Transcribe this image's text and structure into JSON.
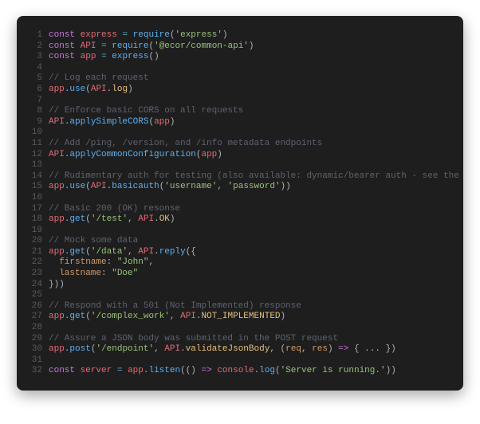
{
  "code": {
    "lines": [
      {
        "n": 1,
        "tokens": [
          [
            "kw",
            "const"
          ],
          [
            "pl",
            " "
          ],
          [
            "id",
            "express"
          ],
          [
            "pl",
            " "
          ],
          [
            "op",
            "="
          ],
          [
            "pl",
            " "
          ],
          [
            "fn",
            "require"
          ],
          [
            "pl",
            "("
          ],
          [
            "str",
            "'express'"
          ],
          [
            "pl",
            ")"
          ]
        ]
      },
      {
        "n": 2,
        "tokens": [
          [
            "kw",
            "const"
          ],
          [
            "pl",
            " "
          ],
          [
            "id",
            "API"
          ],
          [
            "pl",
            " "
          ],
          [
            "op",
            "="
          ],
          [
            "pl",
            " "
          ],
          [
            "fn",
            "require"
          ],
          [
            "pl",
            "("
          ],
          [
            "str",
            "'@ecor/common-api'"
          ],
          [
            "pl",
            ")"
          ]
        ]
      },
      {
        "n": 3,
        "tokens": [
          [
            "kw",
            "const"
          ],
          [
            "pl",
            " "
          ],
          [
            "id",
            "app"
          ],
          [
            "pl",
            " "
          ],
          [
            "op",
            "="
          ],
          [
            "pl",
            " "
          ],
          [
            "fn",
            "express"
          ],
          [
            "pl",
            "()"
          ]
        ]
      },
      {
        "n": 4,
        "tokens": []
      },
      {
        "n": 5,
        "tokens": [
          [
            "cmt",
            "// Log each request"
          ]
        ]
      },
      {
        "n": 6,
        "tokens": [
          [
            "id",
            "app"
          ],
          [
            "pl",
            "."
          ],
          [
            "fn",
            "use"
          ],
          [
            "pl",
            "("
          ],
          [
            "id",
            "API"
          ],
          [
            "pl",
            "."
          ],
          [
            "prop",
            "log"
          ],
          [
            "pl",
            ")"
          ]
        ]
      },
      {
        "n": 7,
        "tokens": []
      },
      {
        "n": 8,
        "tokens": [
          [
            "cmt",
            "// Enforce basic CORS on all requests"
          ]
        ]
      },
      {
        "n": 9,
        "tokens": [
          [
            "id",
            "API"
          ],
          [
            "pl",
            "."
          ],
          [
            "fn",
            "applySimpleCORS"
          ],
          [
            "pl",
            "("
          ],
          [
            "id",
            "app"
          ],
          [
            "pl",
            ")"
          ]
        ]
      },
      {
        "n": 10,
        "tokens": []
      },
      {
        "n": 11,
        "tokens": [
          [
            "cmt",
            "// Add /ping, /version, and /info metadata endpoints"
          ]
        ]
      },
      {
        "n": 12,
        "tokens": [
          [
            "id",
            "API"
          ],
          [
            "pl",
            "."
          ],
          [
            "fn",
            "applyCommonConfiguration"
          ],
          [
            "pl",
            "("
          ],
          [
            "id",
            "app"
          ],
          [
            "pl",
            ")"
          ]
        ]
      },
      {
        "n": 13,
        "tokens": []
      },
      {
        "n": 14,
        "tokens": [
          [
            "cmt",
            "// Rudimentary auth for testing (also available: dynamic/bearer auth - see the docs)"
          ]
        ]
      },
      {
        "n": 15,
        "tokens": [
          [
            "id",
            "app"
          ],
          [
            "pl",
            "."
          ],
          [
            "fn",
            "use"
          ],
          [
            "pl",
            "("
          ],
          [
            "id",
            "API"
          ],
          [
            "pl",
            "."
          ],
          [
            "fn",
            "basicauth"
          ],
          [
            "pl",
            "("
          ],
          [
            "str",
            "'username'"
          ],
          [
            "pl",
            ", "
          ],
          [
            "str",
            "'password'"
          ],
          [
            "pl",
            "))"
          ]
        ]
      },
      {
        "n": 16,
        "tokens": []
      },
      {
        "n": 17,
        "tokens": [
          [
            "cmt",
            "// Basic 200 (OK) resonse"
          ]
        ]
      },
      {
        "n": 18,
        "tokens": [
          [
            "id",
            "app"
          ],
          [
            "pl",
            "."
          ],
          [
            "fn",
            "get"
          ],
          [
            "pl",
            "("
          ],
          [
            "str",
            "'/test'"
          ],
          [
            "pl",
            ", "
          ],
          [
            "id",
            "API"
          ],
          [
            "pl",
            "."
          ],
          [
            "prop",
            "OK"
          ],
          [
            "pl",
            ")"
          ]
        ]
      },
      {
        "n": 19,
        "tokens": []
      },
      {
        "n": 20,
        "tokens": [
          [
            "cmt",
            "// Mock some data"
          ]
        ]
      },
      {
        "n": 21,
        "tokens": [
          [
            "id",
            "app"
          ],
          [
            "pl",
            "."
          ],
          [
            "fn",
            "get"
          ],
          [
            "pl",
            "("
          ],
          [
            "str",
            "'/data'"
          ],
          [
            "pl",
            ", "
          ],
          [
            "id",
            "API"
          ],
          [
            "pl",
            "."
          ],
          [
            "fn",
            "reply"
          ],
          [
            "pl",
            "({"
          ]
        ]
      },
      {
        "n": 22,
        "tokens": [
          [
            "pl",
            "  "
          ],
          [
            "attr",
            "firstname"
          ],
          [
            "pl",
            ": "
          ],
          [
            "str",
            "\"John\""
          ],
          [
            "pl",
            ","
          ]
        ]
      },
      {
        "n": 23,
        "tokens": [
          [
            "pl",
            "  "
          ],
          [
            "attr",
            "lastname"
          ],
          [
            "pl",
            ": "
          ],
          [
            "str",
            "\"Doe\""
          ]
        ]
      },
      {
        "n": 24,
        "tokens": [
          [
            "pl",
            "}))"
          ]
        ]
      },
      {
        "n": 25,
        "tokens": []
      },
      {
        "n": 26,
        "tokens": [
          [
            "cmt",
            "// Respond with a 501 (Not Implemented) response"
          ]
        ]
      },
      {
        "n": 27,
        "tokens": [
          [
            "id",
            "app"
          ],
          [
            "pl",
            "."
          ],
          [
            "fn",
            "get"
          ],
          [
            "pl",
            "("
          ],
          [
            "str",
            "'/complex_work'"
          ],
          [
            "pl",
            ", "
          ],
          [
            "id",
            "API"
          ],
          [
            "pl",
            "."
          ],
          [
            "prop",
            "NOT_IMPLEMENTED"
          ],
          [
            "pl",
            ")"
          ]
        ]
      },
      {
        "n": 28,
        "tokens": []
      },
      {
        "n": 29,
        "tokens": [
          [
            "cmt",
            "// Assure a JSON body was submitted in the POST request"
          ]
        ]
      },
      {
        "n": 30,
        "tokens": [
          [
            "id",
            "app"
          ],
          [
            "pl",
            "."
          ],
          [
            "fn",
            "post"
          ],
          [
            "pl",
            "("
          ],
          [
            "str",
            "'/endpoint'"
          ],
          [
            "pl",
            ", "
          ],
          [
            "id",
            "API"
          ],
          [
            "pl",
            "."
          ],
          [
            "prop",
            "validateJsonBody"
          ],
          [
            "pl",
            ", ("
          ],
          [
            "attr",
            "req"
          ],
          [
            "pl",
            ", "
          ],
          [
            "attr",
            "res"
          ],
          [
            "pl",
            ") "
          ],
          [
            "kw",
            "=>"
          ],
          [
            "pl",
            " { "
          ],
          [
            "pl",
            "..."
          ],
          [
            "pl",
            " })"
          ]
        ]
      },
      {
        "n": 31,
        "tokens": []
      },
      {
        "n": 32,
        "tokens": [
          [
            "kw",
            "const"
          ],
          [
            "pl",
            " "
          ],
          [
            "id",
            "server"
          ],
          [
            "pl",
            " "
          ],
          [
            "op",
            "="
          ],
          [
            "pl",
            " "
          ],
          [
            "id",
            "app"
          ],
          [
            "pl",
            "."
          ],
          [
            "fn",
            "listen"
          ],
          [
            "pl",
            "(() "
          ],
          [
            "kw",
            "=>"
          ],
          [
            "pl",
            " "
          ],
          [
            "id",
            "console"
          ],
          [
            "pl",
            "."
          ],
          [
            "fn",
            "log"
          ],
          [
            "pl",
            "("
          ],
          [
            "str",
            "'Server is running.'"
          ],
          [
            "pl",
            "))"
          ]
        ]
      }
    ]
  }
}
